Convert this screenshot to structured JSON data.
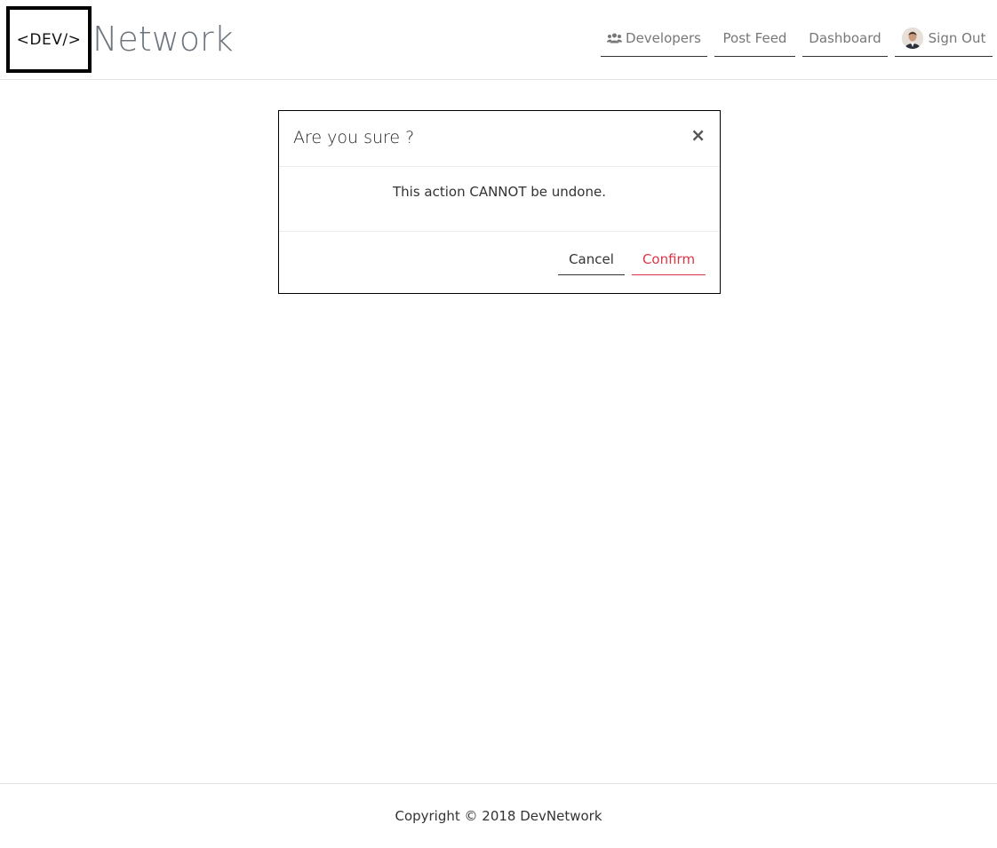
{
  "brand": {
    "logo_text": "<DEV/>",
    "name": "Network"
  },
  "nav": {
    "developers": "Developers",
    "post_feed": "Post Feed",
    "dashboard": "Dashboard",
    "sign_out": "Sign Out"
  },
  "icons": {
    "developers": "users-icon",
    "sign_out": "avatar"
  },
  "modal": {
    "title": "Are you sure ?",
    "close": "×",
    "message": "This action CANNOT be undone.",
    "cancel_label": "Cancel",
    "confirm_label": "Confirm"
  },
  "footer": {
    "copyright": "Copyright © 2018 DevNetwork"
  },
  "colors": {
    "danger": "#dc3545",
    "muted": "#777777",
    "brand_gray": "#6c757d"
  }
}
